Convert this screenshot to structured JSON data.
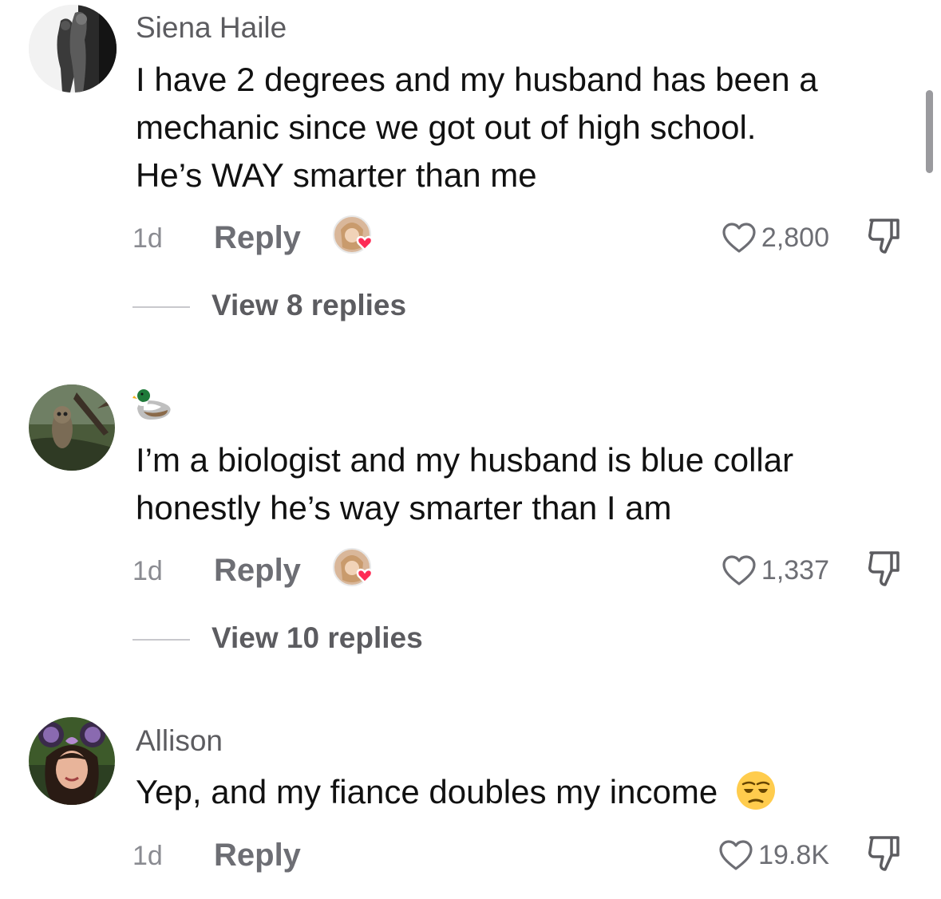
{
  "comments": [
    {
      "username": "Siena Haile",
      "lines": [
        "I have 2 degrees and my husband has been a",
        "mechanic since we got out of high school.",
        "He’s WAY smarter than me"
      ],
      "time": "1d",
      "reply_label": "Reply",
      "likes": "2,800",
      "view_replies": "View 8 replies"
    },
    {
      "username_emoji": "duck-emoji",
      "lines": [
        "I’m a biologist and my husband is blue collar",
        "honestly he’s way smarter than I am"
      ],
      "time": "1d",
      "reply_label": "Reply",
      "likes": "1,337",
      "view_replies": "View 10 replies"
    },
    {
      "username": "Allison",
      "lines": [
        "Yep, and my fiance doubles my income"
      ],
      "trailing_emoji": "unamused-face-emoji",
      "time": "1d",
      "reply_label": "Reply",
      "likes": "19.8K"
    }
  ],
  "colors": {
    "heart_badge": "#fe2c55",
    "secondary_text": "#5c5c60",
    "scrollbar": "#9a9a9e"
  }
}
